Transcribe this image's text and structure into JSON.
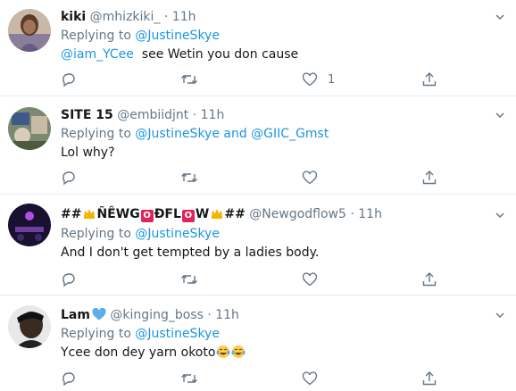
{
  "tweets": [
    {
      "name": "kiki",
      "handle": "@mhizkiki_",
      "separator": "·",
      "time": "11h",
      "reply_prefix": "Replying to",
      "reply_to": "@JustineSkye",
      "mention": "@iam_YCee",
      "text": "see Wetin you don cause",
      "like_count": "1"
    },
    {
      "name": "SITE 15",
      "handle": "@embiidjnt",
      "separator": "·",
      "time": "11h",
      "reply_prefix": "Replying to",
      "reply_to": "@JustineSkye and @GIIC_Gmst",
      "text": "Lol why?"
    },
    {
      "name_prefix": "##",
      "name_part1": "ÑÊWG",
      "name_flag1": "O",
      "name_part2": "ÐFL",
      "name_flag2": "O",
      "name_part3": "W",
      "name_suffix": "##",
      "handle": "@Newgodflow5",
      "separator": "·",
      "time": "11h",
      "reply_prefix": "Replying to",
      "reply_to": "@JustineSkye",
      "text": "And I don't get tempted by a ladies body."
    },
    {
      "name": "Lam",
      "handle": "@kinging_boss",
      "separator": "·",
      "time": "11h",
      "reply_prefix": "Replying to",
      "reply_to": "@JustineSkye",
      "text": "Ycee don dey yarn okoto"
    }
  ],
  "colors": {
    "link": "#1b95e0",
    "secondary": "#657786",
    "divider": "#e6ecf0",
    "text": "#14171a",
    "heart_emoji": "#5dadec",
    "flag": "#e0245e",
    "crown": "#f4b400"
  },
  "icons": [
    "caret-down-icon",
    "reply-icon",
    "retweet-icon",
    "like-icon",
    "share-icon",
    "crown-emoji-icon",
    "blue-heart-emoji-icon",
    "tears-of-joy-emoji-icon"
  ]
}
